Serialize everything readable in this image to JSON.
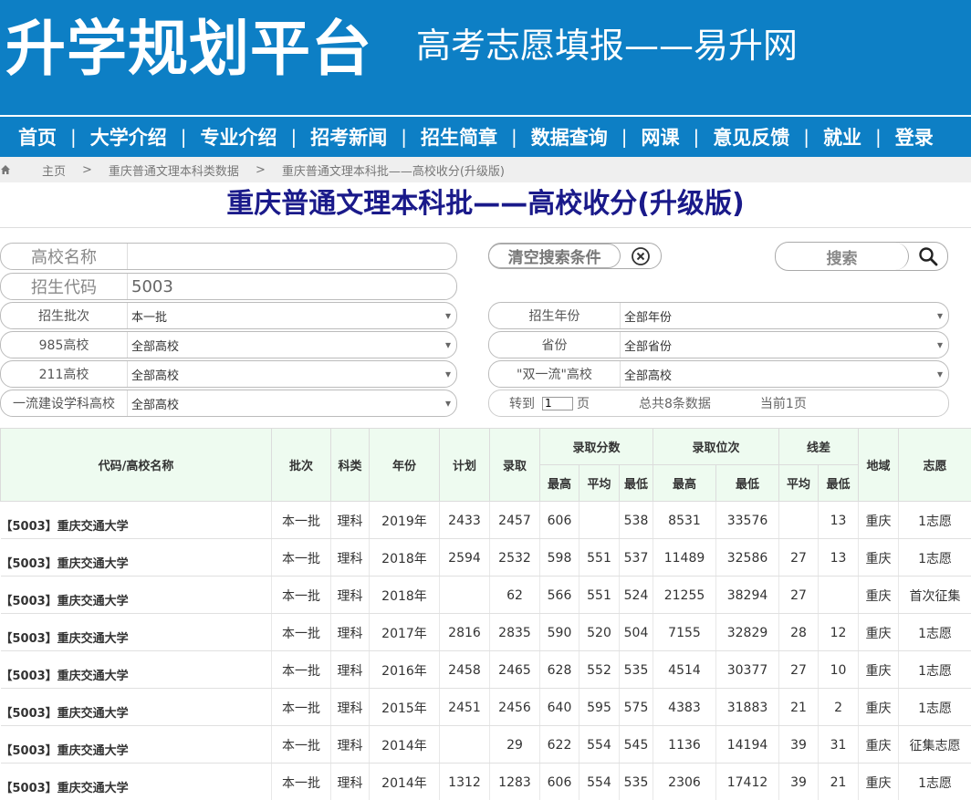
{
  "header": {
    "logo": "升学规划平台",
    "tagline": "高考志愿填报——易升网"
  },
  "nav": [
    "首页",
    "大学介绍",
    "专业介绍",
    "招考新闻",
    "招生简章",
    "数据查询",
    "网课",
    "意见反馈",
    "就业",
    "登录"
  ],
  "breadcrumb": [
    "主页",
    "重庆普通文理本科类数据",
    "重庆普通文理本科批——高校收分(升级版)"
  ],
  "breadcrumb_sep": ">",
  "page_title": "重庆普通文理本科批——高校收分(升级版)",
  "filters": {
    "school_name_label": "高校名称",
    "school_name_value": "",
    "code_label": "招生代码",
    "code_value": "5003",
    "clear_label": "清空搜索条件",
    "search_label": "搜索",
    "batch_label": "招生批次",
    "batch_value": "本一批",
    "year_label": "招生年份",
    "year_value": "全部年份",
    "c985_label": "985高校",
    "c985_value": "全部高校",
    "province_label": "省份",
    "province_value": "全部省份",
    "c211_label": "211高校",
    "c211_value": "全部高校",
    "double_label": "\"双一流\"高校",
    "double_value": "全部高校",
    "discipline_label": "一流建设学科高校",
    "discipline_value": "全部高校"
  },
  "pager": {
    "goto": "转到",
    "page_input": "1",
    "page_unit": "页",
    "total": "总共8条数据",
    "current": "当前1页"
  },
  "table": {
    "headers": {
      "name": "代码/高校名称",
      "batch": "批次",
      "subject": "科类",
      "year": "年份",
      "plan": "计划",
      "admit": "录取",
      "score_group": "录取分数",
      "rank_group": "录取位次",
      "diff_group": "线差",
      "region": "地域",
      "choice": "志愿",
      "score_max": "最高",
      "score_avg": "平均",
      "score_min": "最低",
      "rank_max": "最高",
      "rank_min": "最低",
      "diff_avg": "平均",
      "diff_min": "最低"
    },
    "rows": [
      {
        "name": "【5003】重庆交通大学",
        "batch": "本一批",
        "subject": "理科",
        "year": "2019年",
        "plan": "2433",
        "admit": "2457",
        "smax": "606",
        "savg": "",
        "smin": "538",
        "rmax": "8531",
        "rmin": "33576",
        "davg": "",
        "dmin": "13",
        "region": "重庆",
        "choice": "1志愿"
      },
      {
        "name": "【5003】重庆交通大学",
        "batch": "本一批",
        "subject": "理科",
        "year": "2018年",
        "plan": "2594",
        "admit": "2532",
        "smax": "598",
        "savg": "551",
        "smin": "537",
        "rmax": "11489",
        "rmin": "32586",
        "davg": "27",
        "dmin": "13",
        "region": "重庆",
        "choice": "1志愿"
      },
      {
        "name": "【5003】重庆交通大学",
        "batch": "本一批",
        "subject": "理科",
        "year": "2018年",
        "plan": "",
        "admit": "62",
        "smax": "566",
        "savg": "551",
        "smin": "524",
        "rmax": "21255",
        "rmin": "38294",
        "davg": "27",
        "dmin": "",
        "region": "重庆",
        "choice": "首次征集"
      },
      {
        "name": "【5003】重庆交通大学",
        "batch": "本一批",
        "subject": "理科",
        "year": "2017年",
        "plan": "2816",
        "admit": "2835",
        "smax": "590",
        "savg": "520",
        "smin": "504",
        "rmax": "7155",
        "rmin": "32829",
        "davg": "28",
        "dmin": "12",
        "region": "重庆",
        "choice": "1志愿"
      },
      {
        "name": "【5003】重庆交通大学",
        "batch": "本一批",
        "subject": "理科",
        "year": "2016年",
        "plan": "2458",
        "admit": "2465",
        "smax": "628",
        "savg": "552",
        "smin": "535",
        "rmax": "4514",
        "rmin": "30377",
        "davg": "27",
        "dmin": "10",
        "region": "重庆",
        "choice": "1志愿"
      },
      {
        "name": "【5003】重庆交通大学",
        "batch": "本一批",
        "subject": "理科",
        "year": "2015年",
        "plan": "2451",
        "admit": "2456",
        "smax": "640",
        "savg": "595",
        "smin": "575",
        "rmax": "4383",
        "rmin": "31883",
        "davg": "21",
        "dmin": "2",
        "region": "重庆",
        "choice": "1志愿"
      },
      {
        "name": "【5003】重庆交通大学",
        "batch": "本一批",
        "subject": "理科",
        "year": "2014年",
        "plan": "",
        "admit": "29",
        "smax": "622",
        "savg": "554",
        "smin": "545",
        "rmax": "1136",
        "rmin": "14194",
        "davg": "39",
        "dmin": "31",
        "region": "重庆",
        "choice": "征集志愿"
      },
      {
        "name": "【5003】重庆交通大学",
        "batch": "本一批",
        "subject": "理科",
        "year": "2014年",
        "plan": "1312",
        "admit": "1283",
        "smax": "606",
        "savg": "554",
        "smin": "535",
        "rmax": "2306",
        "rmin": "17412",
        "davg": "39",
        "dmin": "21",
        "region": "重庆",
        "choice": "1志愿"
      }
    ]
  }
}
